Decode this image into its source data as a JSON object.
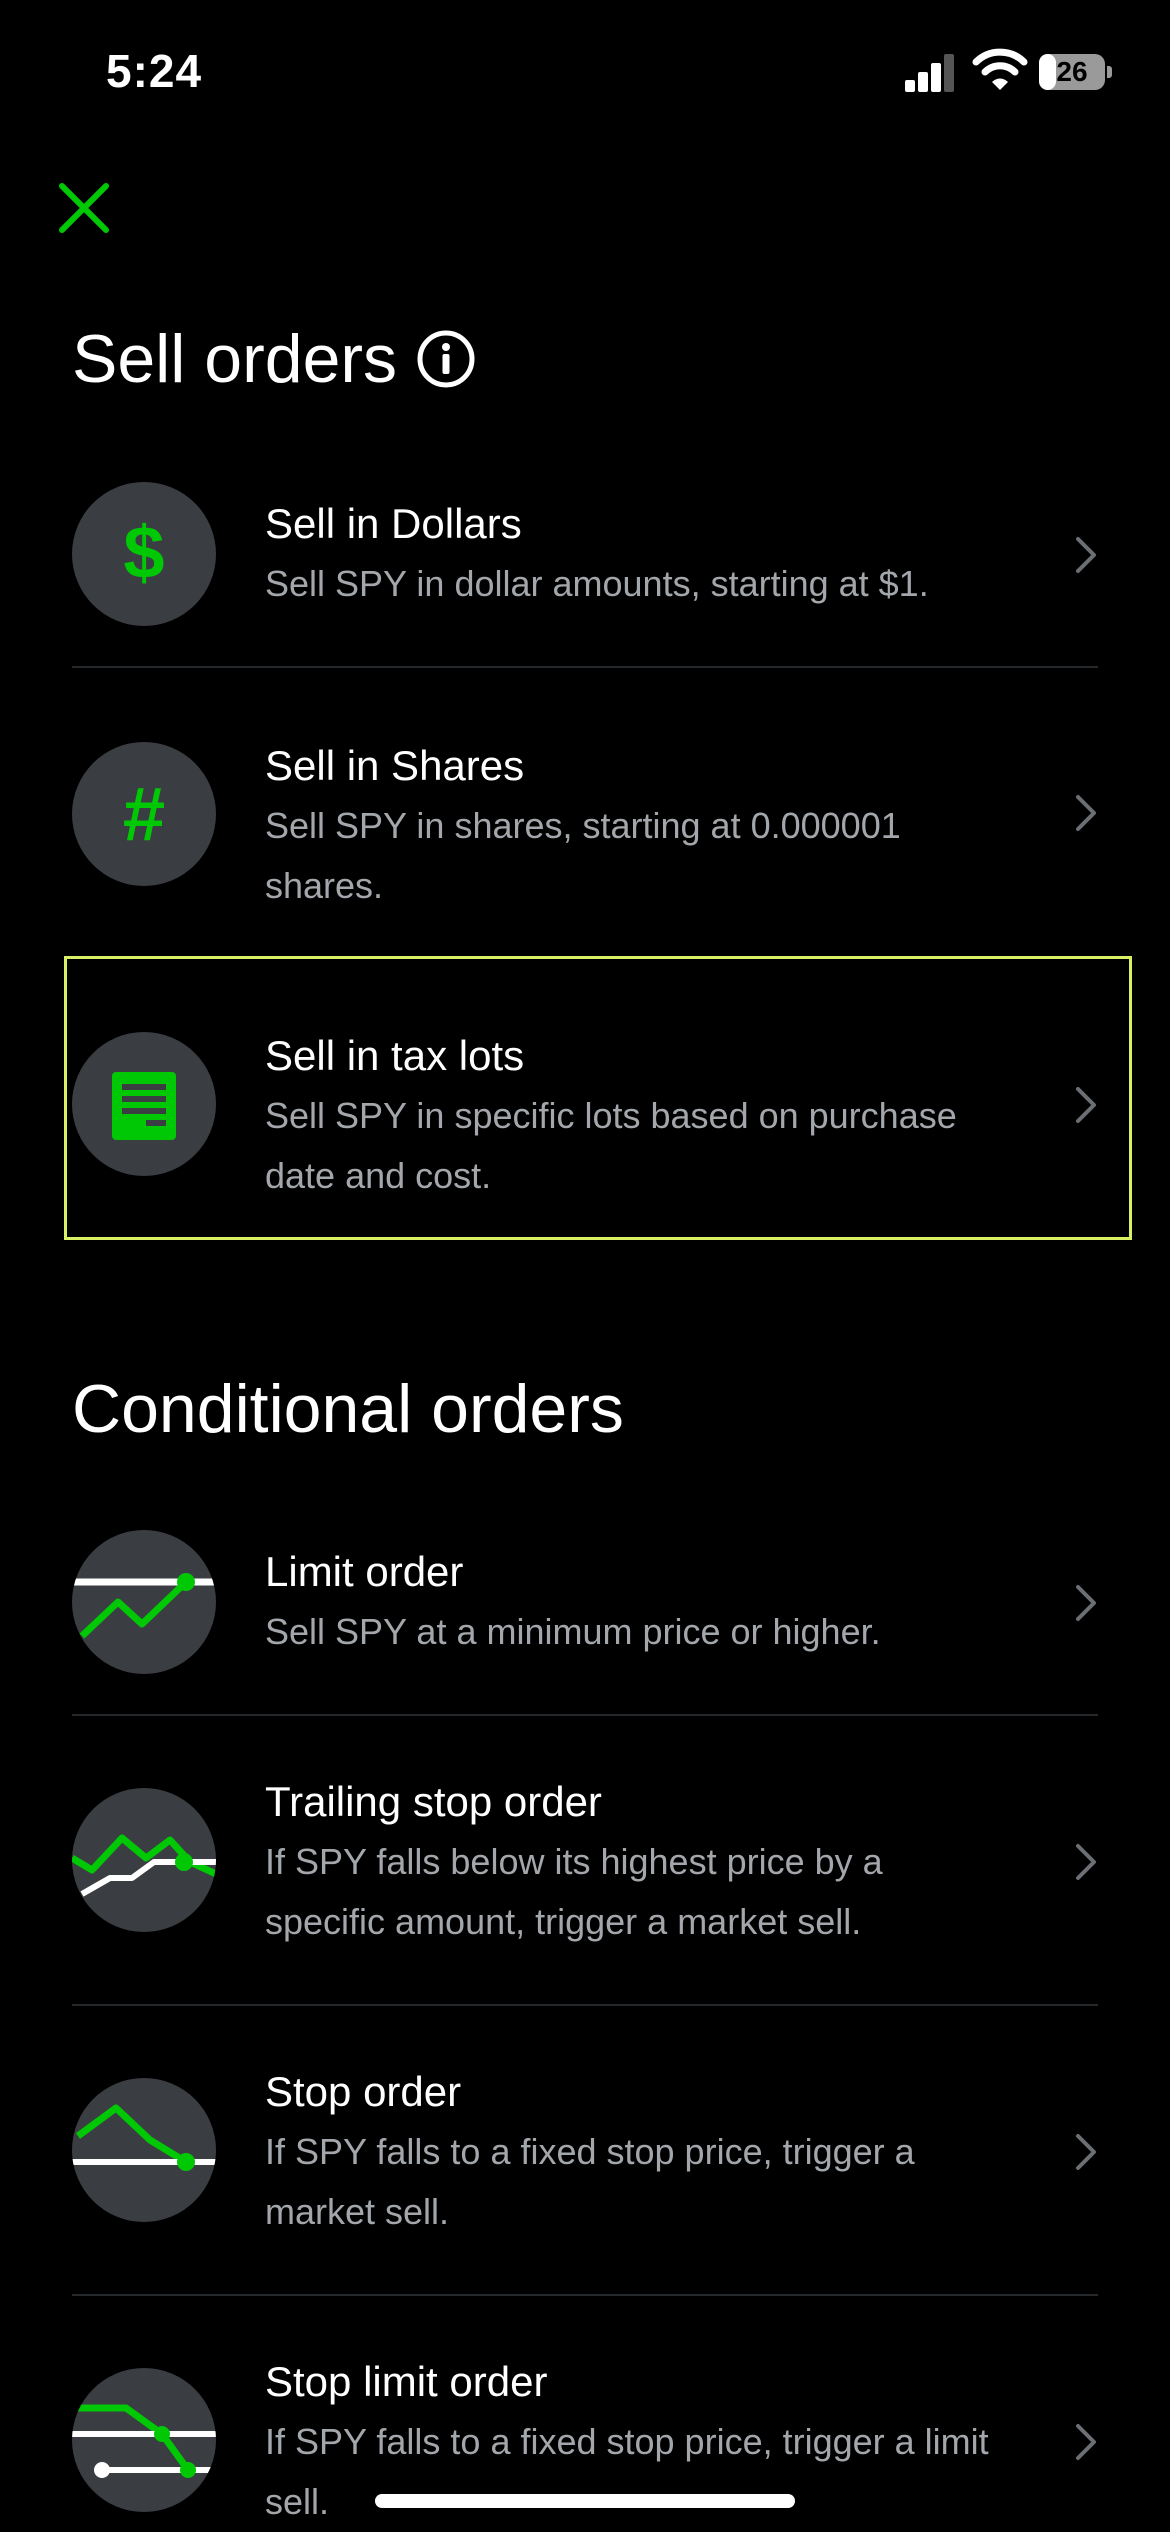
{
  "status_bar": {
    "time": "5:24",
    "battery": "26",
    "battery_level": 0.26
  },
  "header": {
    "close_icon": "close-x-icon"
  },
  "sell_orders": {
    "title": "Sell orders",
    "info_icon": "info-circle-icon",
    "items": [
      {
        "icon": "dollar-sign-icon",
        "title": "Sell in Dollars",
        "description": "Sell SPY in dollar amounts, starting at $1."
      },
      {
        "icon": "hash-icon",
        "title": "Sell in Shares",
        "description": "Sell SPY in shares, starting at 0.000001 shares."
      },
      {
        "icon": "tax-lot-document-icon",
        "title": "Sell in tax lots",
        "description": "Sell SPY in specific lots based on purchase date and cost.",
        "selected": true
      }
    ]
  },
  "conditional_orders": {
    "title": "Conditional orders",
    "items": [
      {
        "icon": "limit-order-chart-icon",
        "title": "Limit order",
        "description": "Sell SPY at a minimum price or higher."
      },
      {
        "icon": "trailing-stop-chart-icon",
        "title": "Trailing stop order",
        "description": "If SPY falls below its highest price by a specific amount, trigger a market sell."
      },
      {
        "icon": "stop-order-chart-icon",
        "title": "Stop order",
        "description": "If SPY falls to a fixed stop price, trigger a market sell."
      },
      {
        "icon": "stop-limit-chart-icon",
        "title": "Stop limit order",
        "description": "If SPY falls to a fixed stop price, trigger a limit sell."
      }
    ]
  },
  "colors": {
    "accent_green": "#00c805",
    "highlight": "#d7f064",
    "background": "#000000",
    "secondary_text": "#a3a7ab",
    "avatar_bg": "#3a3d41"
  }
}
